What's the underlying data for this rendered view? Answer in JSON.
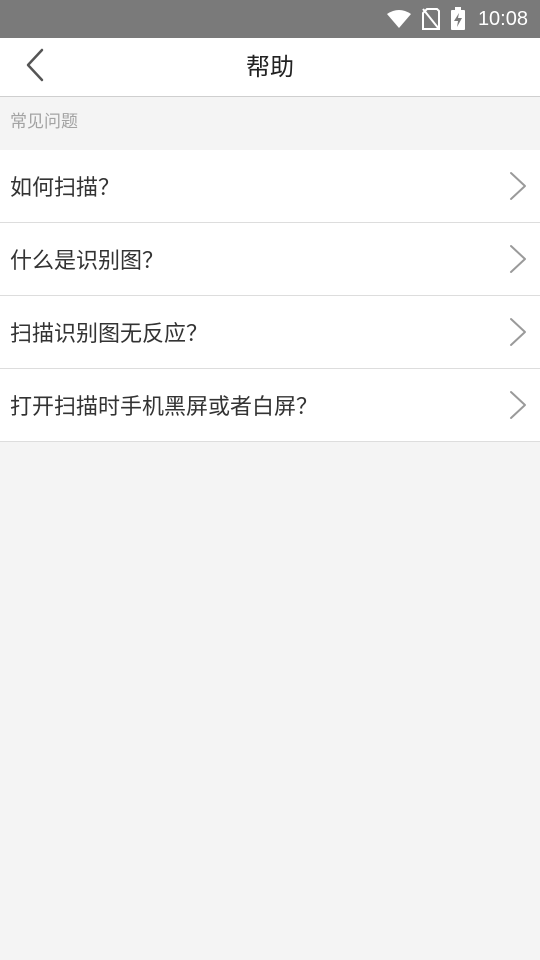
{
  "status_bar": {
    "time": "10:08",
    "icons": [
      "wifi-icon",
      "no-sim-icon",
      "battery-charging-icon"
    ]
  },
  "app_bar": {
    "title": "帮助",
    "back_icon": "chevron-left-icon"
  },
  "section": {
    "header": "常见问题"
  },
  "faq_items": [
    {
      "label": "如何扫描？"
    },
    {
      "label": "什么是识别图？"
    },
    {
      "label": "扫描识别图无反应？"
    },
    {
      "label": "打开扫描时手机黑屏或者白屏？"
    }
  ],
  "colors": {
    "status_bar": "#7a7a7a",
    "background": "#f4f4f4",
    "text_primary": "#333333",
    "text_secondary": "#a3a3a3"
  }
}
